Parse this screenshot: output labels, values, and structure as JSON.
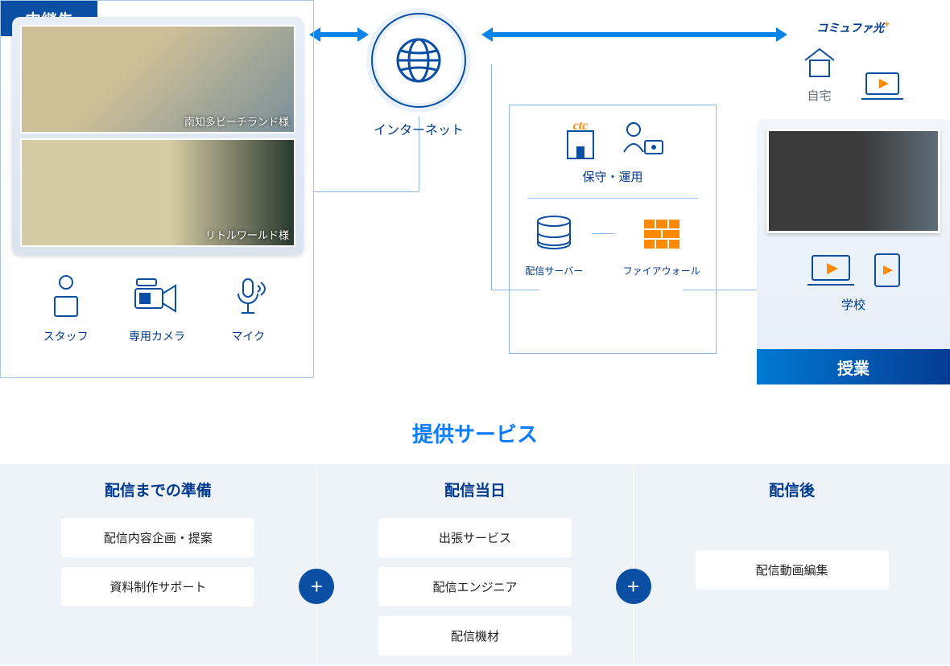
{
  "diagram": {
    "relay_tag": "中継先",
    "photo_captions": [
      "南知多ビーチランド様",
      "リトルワールド様"
    ],
    "equipment": [
      "スタッフ",
      "専用カメラ",
      "マイク"
    ],
    "internet_label": "インターネット",
    "ops": {
      "title": "保守・運用",
      "sub1": "配信サーバー",
      "sub2": "ファイアウォール",
      "ctc": "ctc"
    },
    "home": {
      "brand": "コミュファ光",
      "label": "自宅"
    },
    "class": {
      "label": "学校",
      "tag": "授業"
    }
  },
  "services": {
    "title": "提供サービス",
    "columns": [
      {
        "heading": "配信までの準備",
        "cards": [
          "配信内容企画・提案",
          "資料制作サポート"
        ]
      },
      {
        "heading": "配信当日",
        "cards": [
          "出張サービス",
          "配信エンジニア",
          "配信機材"
        ]
      },
      {
        "heading": "配信後",
        "cards": [
          "配信動画編集"
        ]
      }
    ]
  }
}
